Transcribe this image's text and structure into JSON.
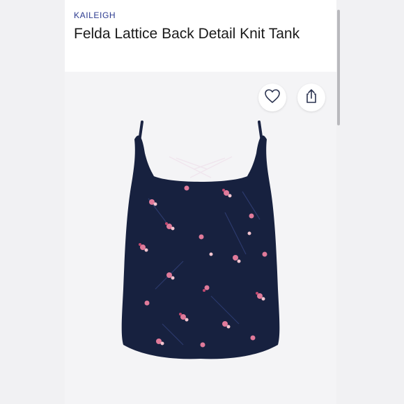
{
  "product": {
    "brand": "KAILEIGH",
    "title": "Felda Lattice Back Detail Knit Tank"
  },
  "actions": {
    "favorite_icon": "heart-icon",
    "share_icon": "share-icon"
  },
  "colors": {
    "brand": "#2b3a8f",
    "garment": "#17213f",
    "flower_pink": "#e07a9a",
    "flower_light": "#f3c4cf"
  }
}
